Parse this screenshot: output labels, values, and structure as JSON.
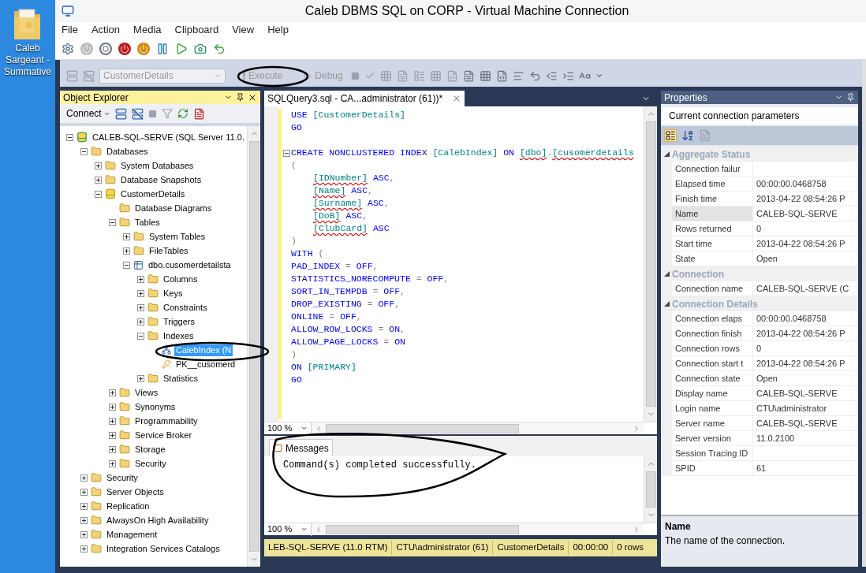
{
  "desktop_icon": {
    "label_lines": [
      "Caleb",
      "Sargeant -",
      "Summative"
    ]
  },
  "window": {
    "title": "Caleb DBMS SQL on CORP - Virtual Machine Connection"
  },
  "menu": [
    "File",
    "Action",
    "Media",
    "Clipboard",
    "View",
    "Help"
  ],
  "ssms_toolbar": {
    "database": "CustomerDetails",
    "execute": "Execute",
    "debug": "Debug"
  },
  "object_explorer": {
    "title": "Object Explorer",
    "connect": "Connect",
    "tree": [
      {
        "label": "CALEB-SQL-SERVE (SQL Server 11.0.",
        "kind": "server",
        "expanded": true,
        "selected": false,
        "children": [
          {
            "label": "Databases",
            "kind": "folder",
            "expanded": true,
            "selected": false,
            "children": [
              {
                "label": "System Databases",
                "kind": "folder",
                "expanded": false,
                "selected": false
              },
              {
                "label": "Database Snapshots",
                "kind": "folder",
                "expanded": false,
                "selected": false
              },
              {
                "label": "CustomerDetails",
                "kind": "database",
                "expanded": true,
                "selected": false,
                "children": [
                  {
                    "label": "Database Diagrams",
                    "kind": "folder",
                    "selected": false
                  },
                  {
                    "label": "Tables",
                    "kind": "folder",
                    "expanded": true,
                    "selected": false,
                    "children": [
                      {
                        "label": "System Tables",
                        "kind": "folder",
                        "expanded": false,
                        "selected": false
                      },
                      {
                        "label": "FileTables",
                        "kind": "folder",
                        "expanded": false,
                        "selected": false
                      },
                      {
                        "label": "dbo.cusomerdetailsta",
                        "kind": "table",
                        "expanded": true,
                        "selected": false,
                        "children": [
                          {
                            "label": "Columns",
                            "kind": "folder",
                            "expanded": false,
                            "selected": false
                          },
                          {
                            "label": "Keys",
                            "kind": "folder",
                            "expanded": false,
                            "selected": false
                          },
                          {
                            "label": "Constraints",
                            "kind": "folder",
                            "expanded": false,
                            "selected": false
                          },
                          {
                            "label": "Triggers",
                            "kind": "folder",
                            "expanded": false,
                            "selected": false
                          },
                          {
                            "label": "Indexes",
                            "kind": "folder",
                            "expanded": true,
                            "selected": false,
                            "children": [
                              {
                                "label": "CalebIndex (N",
                                "kind": "index",
                                "selected": true
                              },
                              {
                                "label": "PK__cusomerd",
                                "kind": "key",
                                "selected": false
                              }
                            ]
                          },
                          {
                            "label": "Statistics",
                            "kind": "folder",
                            "expanded": false,
                            "selected": false
                          }
                        ]
                      }
                    ]
                  },
                  {
                    "label": "Views",
                    "kind": "folder",
                    "expanded": false,
                    "selected": false
                  },
                  {
                    "label": "Synonyms",
                    "kind": "folder",
                    "expanded": false,
                    "selected": false
                  },
                  {
                    "label": "Programmability",
                    "kind": "folder",
                    "expanded": false,
                    "selected": false
                  },
                  {
                    "label": "Service Broker",
                    "kind": "folder",
                    "expanded": false,
                    "selected": false
                  },
                  {
                    "label": "Storage",
                    "kind": "folder",
                    "expanded": false,
                    "selected": false
                  },
                  {
                    "label": "Security",
                    "kind": "folder",
                    "expanded": false,
                    "selected": false
                  }
                ]
              }
            ]
          },
          {
            "label": "Security",
            "kind": "folder",
            "expanded": false,
            "selected": false
          },
          {
            "label": "Server Objects",
            "kind": "folder",
            "expanded": false,
            "selected": false
          },
          {
            "label": "Replication",
            "kind": "folder",
            "expanded": false,
            "selected": false
          },
          {
            "label": "AlwaysOn High Availability",
            "kind": "folder",
            "expanded": false,
            "selected": false
          },
          {
            "label": "Management",
            "kind": "folder",
            "expanded": false,
            "selected": false
          },
          {
            "label": "Integration Services Catalogs",
            "kind": "folder",
            "expanded": false,
            "selected": false
          }
        ]
      }
    ]
  },
  "editor": {
    "tab": "SQLQuery3.sql - CA...administrator (61))*",
    "zoom": "100 %",
    "lines": [
      {
        "kind": "code",
        "segs": [
          {
            "kind": "kw",
            "t": "USE "
          },
          {
            "kind": "id",
            "t": "[CustomerDetails]"
          }
        ]
      },
      {
        "kind": "code",
        "segs": [
          {
            "kind": "kw",
            "t": "GO"
          }
        ]
      },
      {
        "kind": "blank"
      },
      {
        "kind": "fold",
        "segs": [
          {
            "kind": "kw",
            "t": "CREATE NONCLUSTERED INDEX "
          },
          {
            "kind": "id",
            "t": "[CalebIndex]"
          },
          {
            "kind": "kw",
            "t": " ON "
          },
          {
            "kind": "err",
            "t": "[dbo]"
          },
          {
            "kind": "punct",
            "t": "."
          },
          {
            "kind": "err",
            "t": "[cusomerdetails"
          }
        ]
      },
      {
        "kind": "code",
        "segs": [
          {
            "kind": "punct",
            "t": "("
          }
        ]
      },
      {
        "kind": "indented",
        "segs": [
          {
            "kind": "err",
            "t": "[IDNumber]"
          },
          {
            "kind": "kw",
            "t": " ASC"
          },
          {
            "kind": "punct",
            "t": ","
          }
        ]
      },
      {
        "kind": "indented",
        "segs": [
          {
            "kind": "err",
            "t": "[Name]"
          },
          {
            "kind": "kw",
            "t": " ASC"
          },
          {
            "kind": "punct",
            "t": ","
          }
        ]
      },
      {
        "kind": "indented",
        "segs": [
          {
            "kind": "err",
            "t": "[Surname]"
          },
          {
            "kind": "kw",
            "t": " ASC"
          },
          {
            "kind": "punct",
            "t": ","
          }
        ]
      },
      {
        "kind": "indented",
        "segs": [
          {
            "kind": "err",
            "t": "[DoB]"
          },
          {
            "kind": "kw",
            "t": " ASC"
          },
          {
            "kind": "punct",
            "t": ","
          }
        ]
      },
      {
        "kind": "indented",
        "segs": [
          {
            "kind": "err",
            "t": "[ClubCard]"
          },
          {
            "kind": "kw",
            "t": " ASC"
          }
        ]
      },
      {
        "kind": "code",
        "segs": [
          {
            "kind": "punct",
            "t": ")"
          }
        ]
      },
      {
        "kind": "code",
        "segs": [
          {
            "kind": "kw",
            "t": "WITH "
          },
          {
            "kind": "punct",
            "t": "("
          }
        ]
      },
      {
        "kind": "code",
        "segs": [
          {
            "kind": "kw",
            "t": "PAD_INDEX "
          },
          {
            "kind": "punct",
            "t": "= "
          },
          {
            "kind": "kw",
            "t": "OFF"
          },
          {
            "kind": "punct",
            "t": ","
          }
        ]
      },
      {
        "kind": "code",
        "segs": [
          {
            "kind": "kw",
            "t": "STATISTICS_NORECOMPUTE "
          },
          {
            "kind": "punct",
            "t": "= "
          },
          {
            "kind": "kw",
            "t": "OFF"
          },
          {
            "kind": "punct",
            "t": ","
          }
        ]
      },
      {
        "kind": "code",
        "segs": [
          {
            "kind": "kw",
            "t": "SORT_IN_TEMPDB "
          },
          {
            "kind": "punct",
            "t": "= "
          },
          {
            "kind": "kw",
            "t": "OFF"
          },
          {
            "kind": "punct",
            "t": ","
          }
        ]
      },
      {
        "kind": "code",
        "segs": [
          {
            "kind": "kw",
            "t": "DROP_EXISTING "
          },
          {
            "kind": "punct",
            "t": "= "
          },
          {
            "kind": "kw",
            "t": "OFF"
          },
          {
            "kind": "punct",
            "t": ","
          }
        ]
      },
      {
        "kind": "code",
        "segs": [
          {
            "kind": "kw",
            "t": "ONLINE "
          },
          {
            "kind": "punct",
            "t": "= "
          },
          {
            "kind": "kw",
            "t": "OFF"
          },
          {
            "kind": "punct",
            "t": ","
          }
        ]
      },
      {
        "kind": "code",
        "segs": [
          {
            "kind": "kw",
            "t": "ALLOW_ROW_LOCKS "
          },
          {
            "kind": "punct",
            "t": "= "
          },
          {
            "kind": "kw",
            "t": "ON"
          },
          {
            "kind": "punct",
            "t": ","
          }
        ]
      },
      {
        "kind": "code",
        "segs": [
          {
            "kind": "kw",
            "t": "ALLOW_PAGE_LOCKS "
          },
          {
            "kind": "punct",
            "t": "= "
          },
          {
            "kind": "kw",
            "t": "ON"
          }
        ]
      },
      {
        "kind": "code",
        "segs": [
          {
            "kind": "punct",
            "t": ")"
          }
        ]
      },
      {
        "kind": "code",
        "segs": [
          {
            "kind": "kw",
            "t": "ON "
          },
          {
            "kind": "id",
            "t": "[PRIMARY]"
          }
        ]
      },
      {
        "kind": "code",
        "segs": [
          {
            "kind": "kw",
            "t": "GO"
          }
        ]
      }
    ]
  },
  "results": {
    "tab": "Messages",
    "message": "Command(s) completed successfully.",
    "zoom": "100 %"
  },
  "status_bar": [
    "LEB-SQL-SERVE (11.0 RTM)",
    "CTU\\administrator (61)",
    "CustomerDetails",
    "00:00:00",
    "0 rows"
  ],
  "properties": {
    "title": "Properties",
    "object": "Current connection parameters",
    "groups": [
      {
        "name": "Aggregate Status",
        "expanded": true,
        "rows": [
          {
            "name": "Connection failur",
            "value": "",
            "selected": false
          },
          {
            "name": "Elapsed time",
            "value": "00:00:00.0468758",
            "selected": false
          },
          {
            "name": "Finish time",
            "value": "2013-04-22 08:54:26 P",
            "selected": false
          },
          {
            "name": "Name",
            "value": "CALEB-SQL-SERVE",
            "selected": true
          },
          {
            "name": "Rows returned",
            "value": "0",
            "selected": false
          },
          {
            "name": "Start time",
            "value": "2013-04-22 08:54:26 P",
            "selected": false
          },
          {
            "name": "State",
            "value": "Open",
            "selected": false
          }
        ]
      },
      {
        "name": "Connection",
        "expanded": true,
        "rows": [
          {
            "name": "Connection name",
            "value": "CALEB-SQL-SERVE (C",
            "selected": false
          }
        ]
      },
      {
        "name": "Connection Details",
        "expanded": true,
        "rows": [
          {
            "name": "Connection elaps",
            "value": "00:00:00.0468758",
            "selected": false
          },
          {
            "name": "Connection finish",
            "value": "2013-04-22 08:54:26 P",
            "selected": false
          },
          {
            "name": "Connection rows",
            "value": "0",
            "selected": false
          },
          {
            "name": "Connection start t",
            "value": "2013-04-22 08:54:26 P",
            "selected": false
          },
          {
            "name": "Connection state",
            "value": "Open",
            "selected": false
          },
          {
            "name": "Display name",
            "value": "CALEB-SQL-SERVE",
            "selected": false
          },
          {
            "name": "Login name",
            "value": "CTU\\administrator",
            "selected": false
          },
          {
            "name": "Server name",
            "value": "CALEB-SQL-SERVE",
            "selected": false
          },
          {
            "name": "Server version",
            "value": "11.0.2100",
            "selected": false
          },
          {
            "name": "Session Tracing ID",
            "value": "",
            "selected": false
          },
          {
            "name": "SPID",
            "value": "61",
            "selected": false
          }
        ]
      }
    ],
    "description": {
      "title": "Name",
      "text": "The name of the connection."
    }
  }
}
